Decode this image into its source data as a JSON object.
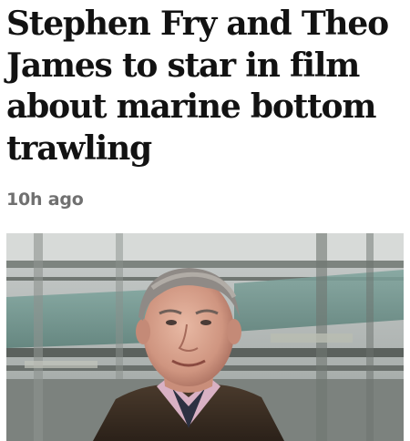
{
  "article": {
    "headline": "Stephen Fry and Theo James to star in film about marine bottom trawling",
    "age": "10h ago",
    "image_icon": "portrait-photo"
  }
}
